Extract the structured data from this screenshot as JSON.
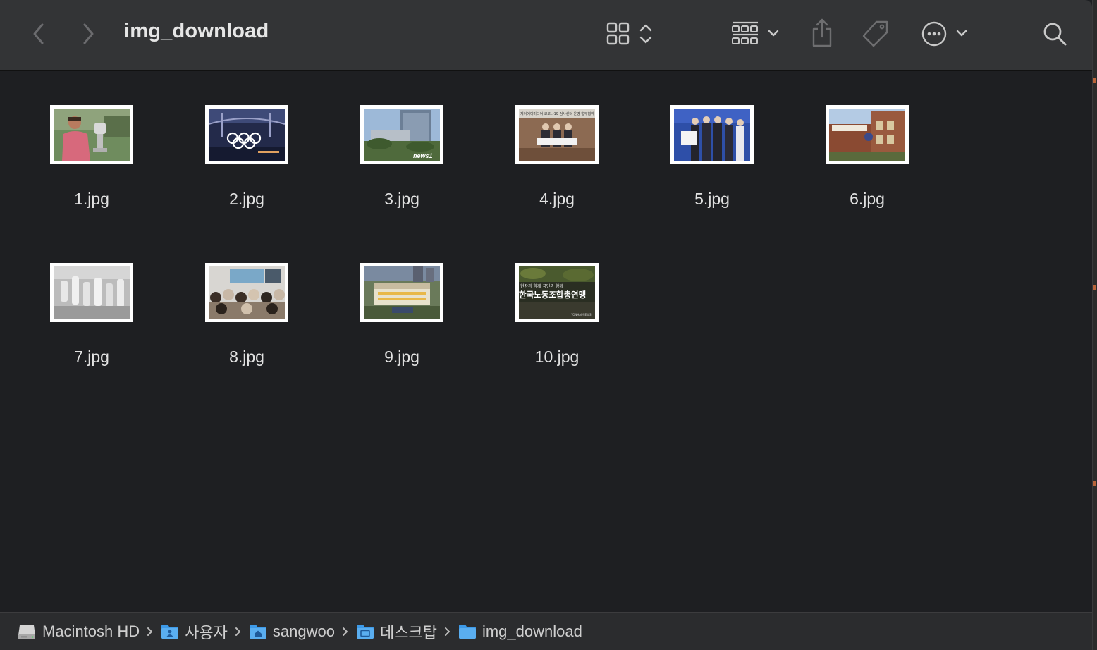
{
  "window": {
    "title": "img_download"
  },
  "toolbar": {
    "icons": {
      "back": "chevron-left-icon",
      "forward": "chevron-right-icon",
      "view": "grid-view-icon",
      "group": "group-by-icon",
      "share": "share-icon",
      "tag": "tag-icon",
      "more": "ellipsis-circle-icon",
      "search": "search-icon"
    }
  },
  "files": [
    {
      "name": "1.jpg"
    },
    {
      "name": "2.jpg"
    },
    {
      "name": "3.jpg"
    },
    {
      "name": "4.jpg"
    },
    {
      "name": "5.jpg"
    },
    {
      "name": "6.jpg"
    },
    {
      "name": "7.jpg"
    },
    {
      "name": "8.jpg"
    },
    {
      "name": "9.jpg"
    },
    {
      "name": "10.jpg"
    }
  ],
  "thumbnails": {
    "t3_text": "news1",
    "t4_text": "제이에이미디어 코로나19 검사센터 운영 업무협약",
    "t10_line1": "현장과 함께 국민과 함께",
    "t10_line2": "한국노동조합총연맹",
    "t10_logo": "YONHAPNEWS"
  },
  "pathbar": {
    "items": [
      {
        "label": "Macintosh HD",
        "icon": "hard-drive-icon"
      },
      {
        "label": "사용자",
        "icon": "users-folder-icon"
      },
      {
        "label": "sangwoo",
        "icon": "home-folder-icon"
      },
      {
        "label": "데스크탑",
        "icon": "desktop-folder-icon"
      },
      {
        "label": "img_download",
        "icon": "folder-icon"
      }
    ]
  },
  "colors": {
    "toolbar_bg": "#333436",
    "content_bg": "#1e1f22",
    "pathbar_bg": "#2b2c2e",
    "text": "#e2e2e2",
    "folder_blue": "#3d9ae8"
  }
}
